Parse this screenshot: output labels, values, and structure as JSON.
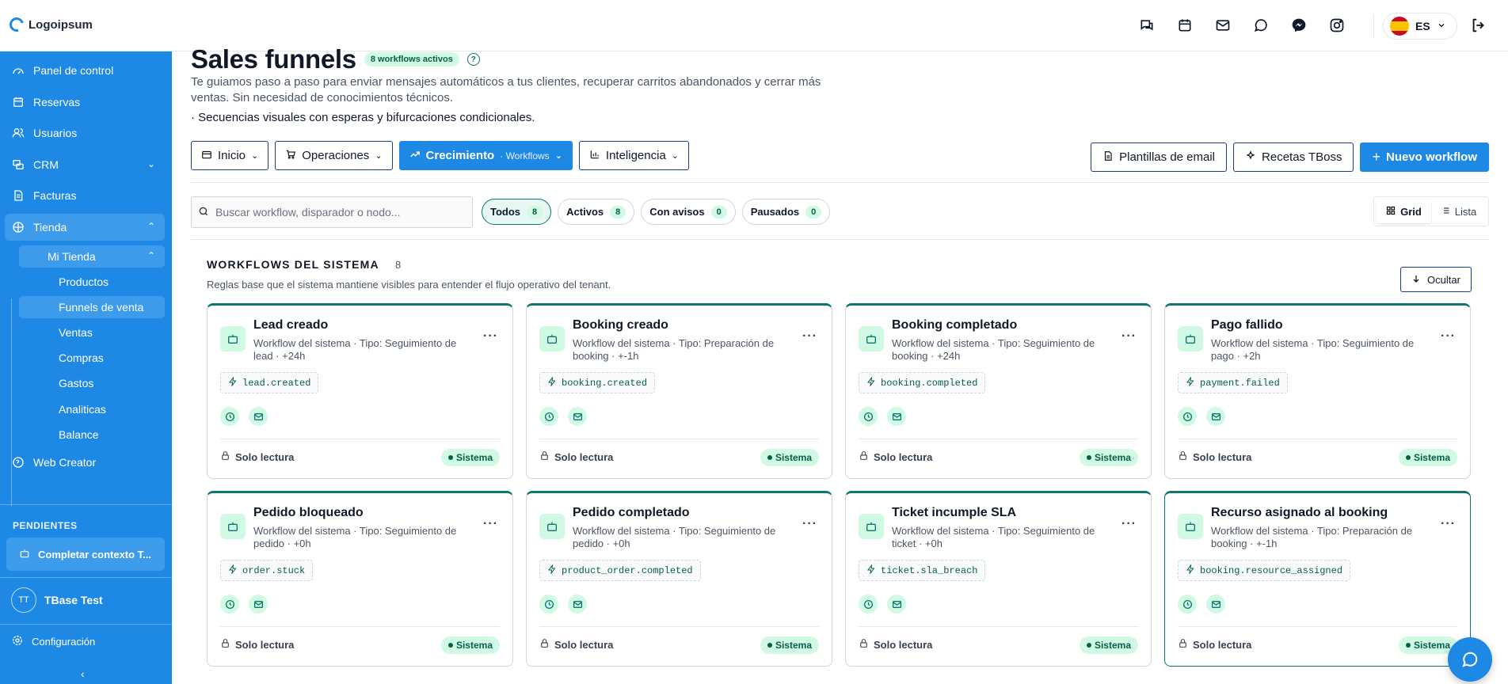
{
  "brand": {
    "name": "Logoipsum"
  },
  "header": {
    "language": "ES",
    "icons": [
      "chat-icon",
      "calendar-icon",
      "mail-icon",
      "whatsapp-icon",
      "messenger-icon",
      "instagram-icon"
    ]
  },
  "sidebar": {
    "items": [
      {
        "label": "Panel de control",
        "icon": "dashboard-icon"
      },
      {
        "label": "Reservas",
        "icon": "calendar-icon"
      },
      {
        "label": "Usuarios",
        "icon": "users-icon"
      },
      {
        "label": "CRM",
        "icon": "crm-icon"
      },
      {
        "label": "Facturas",
        "icon": "invoice-icon"
      },
      {
        "label": "Tienda",
        "icon": "store-icon"
      },
      {
        "label": "Web Creator",
        "icon": "globe-icon"
      }
    ],
    "store": {
      "label": "Mi Tienda",
      "items": [
        "Productos",
        "Funnels de venta",
        "Ventas",
        "Compras",
        "Gastos",
        "Analiticas",
        "Balance"
      ],
      "selected": "Funnels de venta"
    },
    "pending": {
      "title": "PENDIENTES",
      "item": "Completar contexto T..."
    },
    "user": {
      "initials": "TT",
      "name": "TBase Test"
    },
    "config": "Configuración"
  },
  "page": {
    "title": "Sales funnels",
    "active_badge": "8 workflows activos",
    "description": "Te guiamos paso a paso para enviar mensajes automáticos a tus clientes, recuperar carritos abandonados y cerrar más ventas. Sin necesidad de conocimientos técnicos.",
    "bullet": "· Secuencias visuales con esperas y bifurcaciones condicionales.",
    "tabs": [
      {
        "label": "Inicio"
      },
      {
        "label": "Operaciones"
      },
      {
        "label": "Crecimiento",
        "sub": "· Workflows",
        "active": true
      },
      {
        "label": "Inteligencia"
      }
    ],
    "actions": {
      "email_templates": "Plantillas de email",
      "recipes": "Recetas TBoss",
      "new_workflow": "Nuevo workflow"
    },
    "search_placeholder": "Buscar workflow, disparador o nodo...",
    "filters": [
      {
        "label": "Todos",
        "count": "8"
      },
      {
        "label": "Activos",
        "count": "8"
      },
      {
        "label": "Con avisos",
        "count": "0"
      },
      {
        "label": "Pausados",
        "count": "0"
      }
    ],
    "view": {
      "grid": "Grid",
      "list": "Lista"
    }
  },
  "section": {
    "title": "WORKFLOWS DEL SISTEMA",
    "count": "8",
    "description": "Reglas base que el sistema mantiene visibles para entender el flujo operativo del tenant.",
    "hide": "Ocultar",
    "readonly": "Solo lectura",
    "badge": "Sistema",
    "cards": [
      {
        "title": "Lead creado",
        "subtitle": "Workflow del sistema · Tipo: Seguimiento de lead · +24h",
        "trigger": "lead.created"
      },
      {
        "title": "Booking creado",
        "subtitle": "Workflow del sistema · Tipo: Preparación de booking · +-1h",
        "trigger": "booking.created"
      },
      {
        "title": "Booking completado",
        "subtitle": "Workflow del sistema · Tipo: Seguimiento de booking · +24h",
        "trigger": "booking.completed"
      },
      {
        "title": "Pago fallido",
        "subtitle": "Workflow del sistema · Tipo: Seguimiento de pago · +2h",
        "trigger": "payment.failed"
      },
      {
        "title": "Pedido bloqueado",
        "subtitle": "Workflow del sistema · Tipo: Seguimiento de pedido · +0h",
        "trigger": "order.stuck"
      },
      {
        "title": "Pedido completado",
        "subtitle": "Workflow del sistema · Tipo: Seguimiento de pedido · +0h",
        "trigger": "product_order.completed"
      },
      {
        "title": "Ticket incumple SLA",
        "subtitle": "Workflow del sistema · Tipo: Seguimiento de ticket · +0h",
        "trigger": "ticket.sla_breach"
      },
      {
        "title": "Recurso asignado al booking",
        "subtitle": "Workflow del sistema · Tipo: Preparación de booking · +-1h",
        "trigger": "booking.resource_assigned"
      }
    ]
  },
  "colors": {
    "primary": "#1e88e5",
    "accent": "#0f766e",
    "badge_bg": "#d1fae5"
  }
}
